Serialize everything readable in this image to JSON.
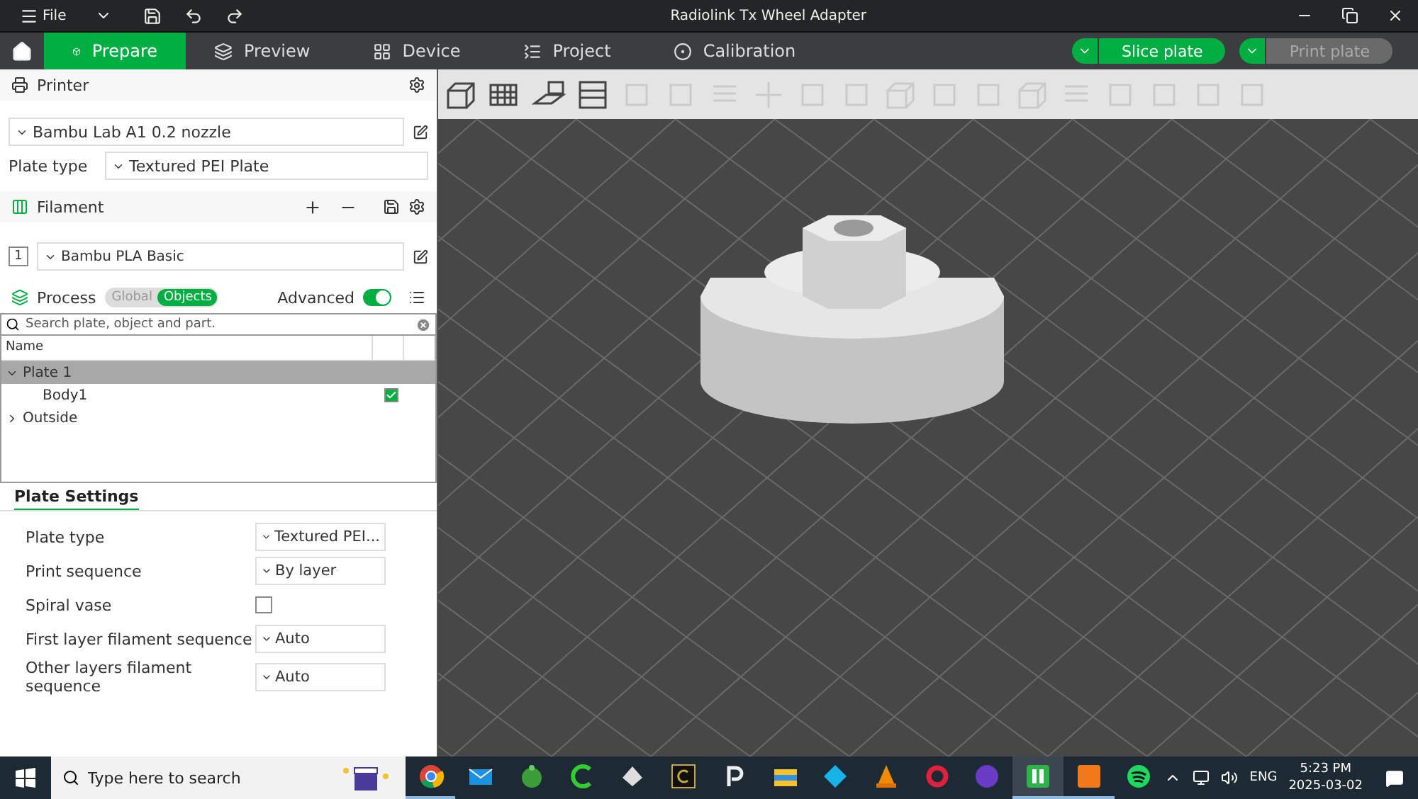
{
  "title_bar": {
    "menu": "File",
    "title": "Radiolink Tx Wheel Adapter"
  },
  "tabs": [
    {
      "kind": "prepare",
      "label": "Prepare",
      "selected": true
    },
    {
      "kind": "preview",
      "label": "Preview",
      "selected": false
    },
    {
      "kind": "device",
      "label": "Device",
      "selected": false
    },
    {
      "kind": "project",
      "label": "Project",
      "selected": false
    },
    {
      "kind": "calibration",
      "label": "Calibration",
      "selected": false
    }
  ],
  "actions": [
    {
      "label": "Slice plate",
      "disabled": false
    },
    {
      "label": "Print plate",
      "disabled": true
    }
  ],
  "toolbar_buttons": [
    {
      "kind": "cube",
      "disabled": false
    },
    {
      "kind": "grid",
      "disabled": false
    },
    {
      "kind": "plate",
      "disabled": false
    },
    {
      "kind": "layout",
      "disabled": false
    },
    {
      "kind": "square",
      "disabled": true
    },
    {
      "kind": "square",
      "disabled": true
    },
    {
      "kind": "lines",
      "disabled": true
    },
    {
      "kind": "move",
      "disabled": true
    },
    {
      "kind": "square",
      "disabled": true
    },
    {
      "kind": "square",
      "disabled": true
    },
    {
      "kind": "cube",
      "disabled": true
    },
    {
      "kind": "square",
      "disabled": true
    },
    {
      "kind": "square",
      "disabled": true
    },
    {
      "kind": "cube",
      "disabled": true
    },
    {
      "kind": "lines",
      "disabled": true
    },
    {
      "kind": "square",
      "disabled": true
    },
    {
      "kind": "square",
      "disabled": true
    },
    {
      "kind": "square",
      "disabled": true
    },
    {
      "kind": "square",
      "disabled": true
    }
  ],
  "printer": {
    "heading": "Printer",
    "preset": "Bambu Lab A1 0.2 nozzle",
    "plate_type_label": "Plate type",
    "plate_type": "Textured PEI Plate"
  },
  "filament": {
    "heading": "Filament",
    "items": [
      {
        "index": "1",
        "name": "Bambu PLA Basic"
      }
    ]
  },
  "process": {
    "heading": "Process",
    "modes": [
      {
        "label": "Global",
        "selected": false
      },
      {
        "label": "Objects",
        "selected": true
      }
    ],
    "advanced_label": "Advanced",
    "advanced_on": true
  },
  "object_list": {
    "search_placeholder": "Search plate, object and part.",
    "column": "Name",
    "tree": [
      {
        "label": "Plate 1",
        "expanded": true,
        "selected": true,
        "children": [
          {
            "label": "Body1",
            "checked": true
          }
        ]
      },
      {
        "label": "Outside",
        "expanded": false,
        "selected": false
      }
    ]
  },
  "plate_settings": {
    "tab": "Plate Settings",
    "rows": [
      {
        "kind": "select",
        "label": "Plate type",
        "value": "Textured PEI..."
      },
      {
        "kind": "select",
        "label": "Print sequence",
        "value": "By layer"
      },
      {
        "kind": "checkbox",
        "label": "Spiral vase",
        "checked": false
      },
      {
        "kind": "select",
        "label": "First layer filament sequence",
        "value": "Auto"
      },
      {
        "kind": "select",
        "label": "Other layers filament sequence",
        "value": "Auto"
      }
    ]
  },
  "taskbar": {
    "search_placeholder": "Type here to search",
    "language": "ENG",
    "time": "5:23 PM",
    "date": "2025-03-02",
    "apps": [
      {
        "kind": "chrome",
        "open": true,
        "selected": false
      },
      {
        "kind": "mail",
        "open": false,
        "selected": false
      },
      {
        "kind": "greenround",
        "open": false,
        "selected": false
      },
      {
        "kind": "greenc",
        "open": false,
        "selected": false
      },
      {
        "kind": "diamond",
        "open": false,
        "selected": false
      },
      {
        "kind": "darkc",
        "open": false,
        "selected": false
      },
      {
        "kind": "p",
        "open": false,
        "selected": false
      },
      {
        "kind": "folder",
        "open": false,
        "selected": false
      },
      {
        "kind": "kodi",
        "open": false,
        "selected": false
      },
      {
        "kind": "cone",
        "open": false,
        "selected": false
      },
      {
        "kind": "redring",
        "open": false,
        "selected": false
      },
      {
        "kind": "tv",
        "open": false,
        "selected": false
      },
      {
        "kind": "greenapp",
        "open": true,
        "selected": true
      },
      {
        "kind": "orange",
        "open": true,
        "selected": false
      },
      {
        "kind": "spotify",
        "open": false,
        "selected": false
      }
    ]
  }
}
